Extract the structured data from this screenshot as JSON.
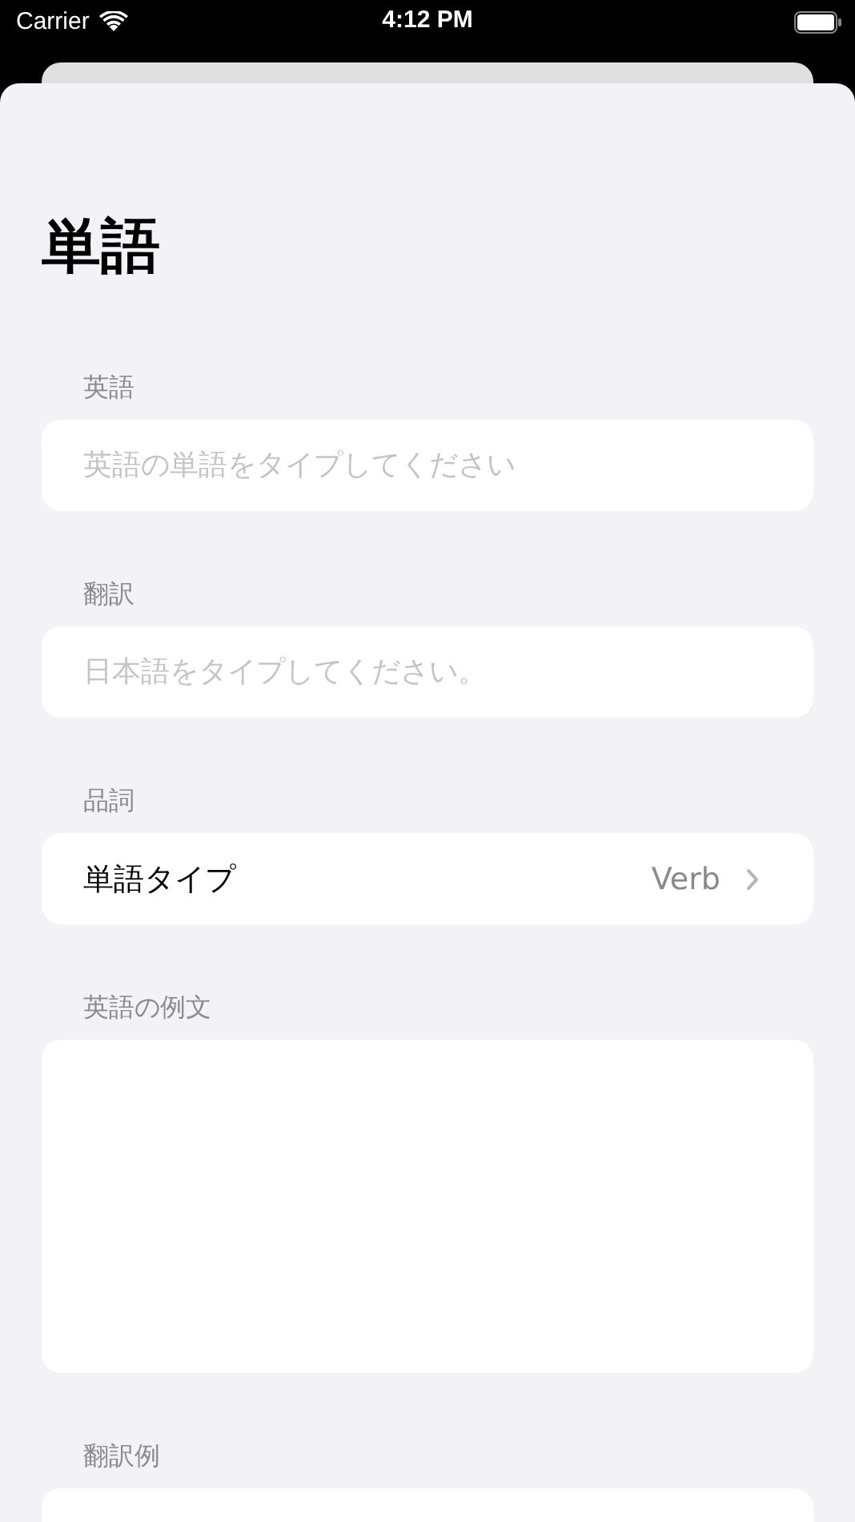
{
  "status_bar": {
    "carrier": "Carrier",
    "time": "4:12 PM"
  },
  "title": "単語",
  "sections": [
    {
      "kind": "text",
      "label": "英語",
      "placeholder": "英語の単語をタイプしてください"
    },
    {
      "kind": "text",
      "label": "翻訳",
      "placeholder": "日本語をタイプしてください。"
    },
    {
      "kind": "picker",
      "label": "品詞",
      "row_label": "単語タイプ",
      "value": "Verb"
    },
    {
      "kind": "textarea",
      "label": "英語の例文"
    },
    {
      "kind": "textarea",
      "label": "翻訳例"
    }
  ]
}
